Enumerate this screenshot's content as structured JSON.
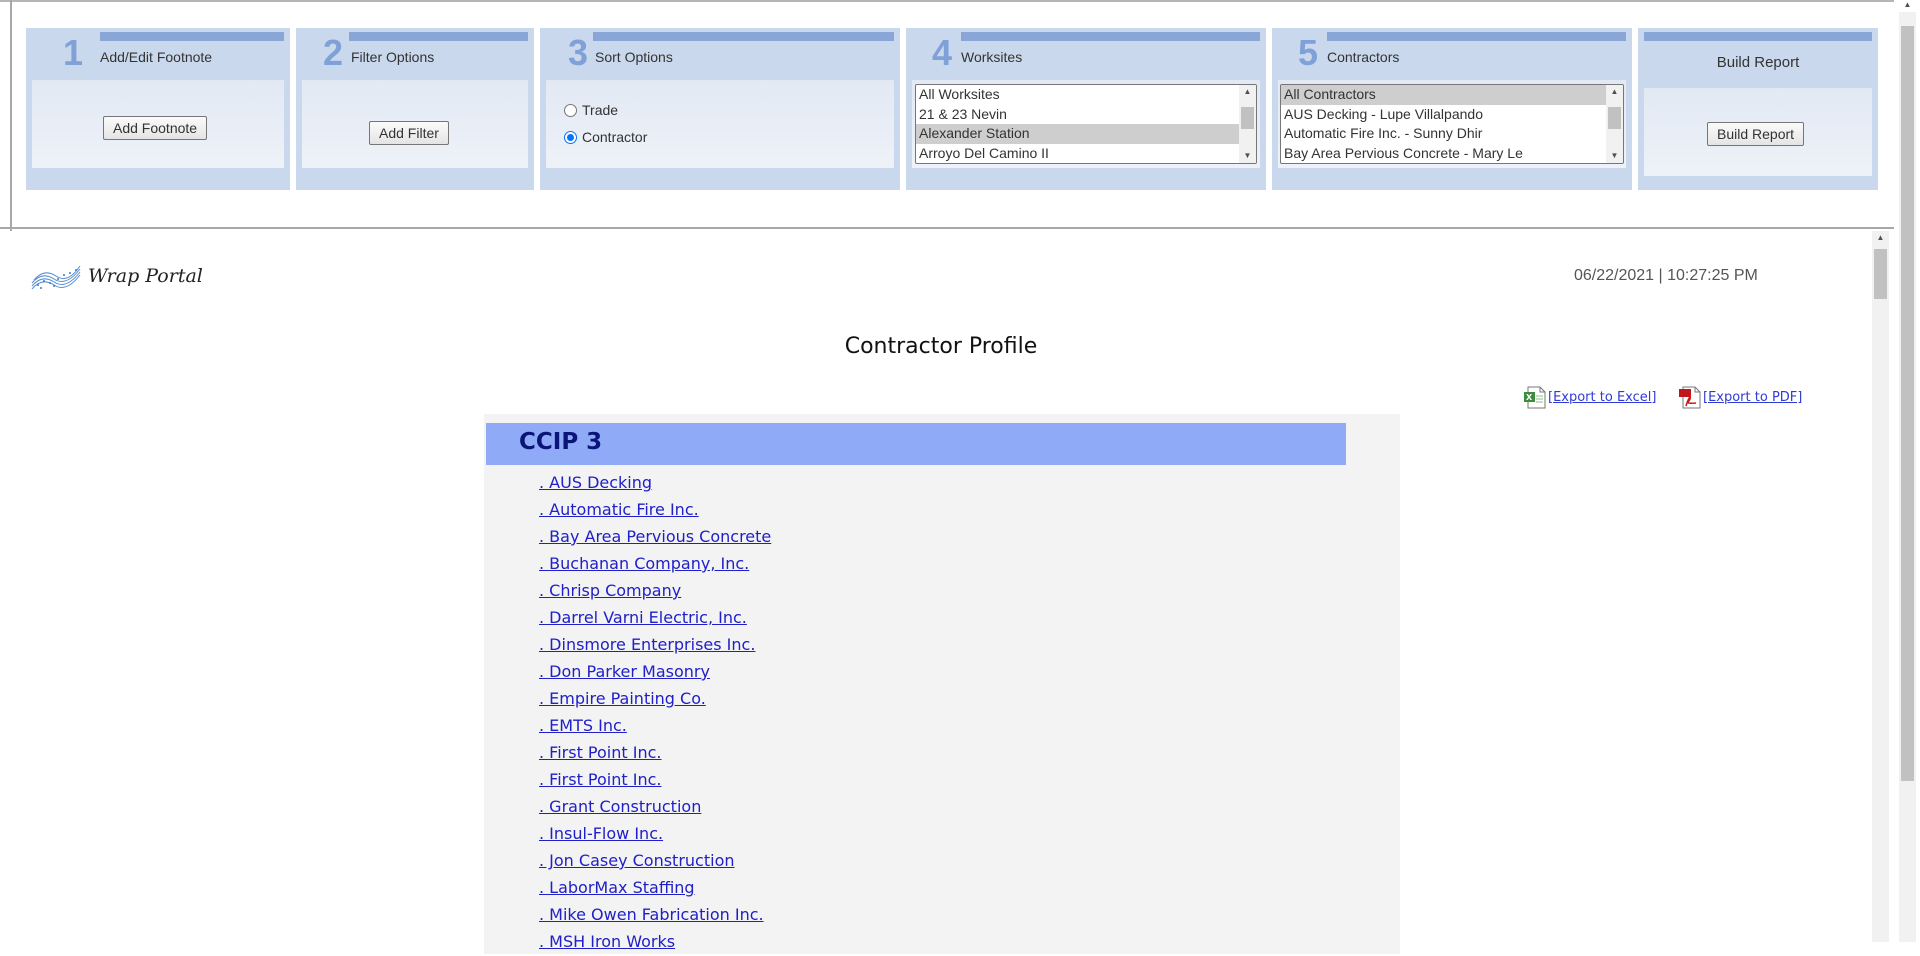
{
  "panels": {
    "footnote": {
      "num": "1",
      "title": "Add/Edit Footnote",
      "button": "Add Footnote"
    },
    "filter": {
      "num": "2",
      "title": "Filter Options",
      "button": "Add Filter"
    },
    "sort": {
      "num": "3",
      "title": "Sort Options",
      "options": [
        "Trade",
        "Contractor"
      ],
      "selected": "Contractor"
    },
    "worksites": {
      "num": "4",
      "title": "Worksites",
      "options": [
        "All Worksites",
        "21 & 23 Nevin",
        "Alexander Station",
        "Arroyo Del Camino II"
      ],
      "selected": "Alexander Station"
    },
    "contractors": {
      "num": "5",
      "title": "Contractors",
      "options": [
        "All Contractors",
        "AUS Decking - Lupe Villalpando",
        "Automatic Fire Inc. - Sunny Dhir",
        "Bay Area Pervious Concrete - Mary Le"
      ],
      "selected": "All Contractors"
    },
    "build": {
      "title": "Build Report",
      "button": "Build Report"
    }
  },
  "report": {
    "logo_text": "Wrap Portal",
    "timestamp": "06/22/2021 | 10:27:25 PM",
    "title": "Contractor Profile",
    "export_excel": "[Export to Excel]",
    "export_pdf": "[Export to PDF]",
    "group": "CCIP 3",
    "contractors": [
      ". AUS Decking",
      ". Automatic Fire Inc.",
      ". Bay Area Pervious Concrete",
      ". Buchanan Company, Inc.",
      ". Chrisp Company",
      ". Darrel Varni Electric, Inc.",
      ". Dinsmore Enterprises Inc.",
      ". Don Parker Masonry",
      ". Empire Painting Co.",
      ". EMTS Inc.",
      ". First Point Inc.",
      ". First Point Inc.",
      ". Grant Construction",
      ". Insul-Flow Inc.",
      ". Jon Casey Construction",
      ". LaborMax Staffing",
      ". Mike Owen Fabrication Inc.",
      ". MSH Iron Works"
    ]
  },
  "colors": {
    "panel_bg": "#c9d8ec",
    "panel_bar": "#8aa6d6",
    "group_header": "#8fabf7",
    "link": "#2020c8"
  },
  "icons": {
    "excel": "excel-icon",
    "pdf": "pdf-icon",
    "logo": "wave-logo-icon"
  }
}
